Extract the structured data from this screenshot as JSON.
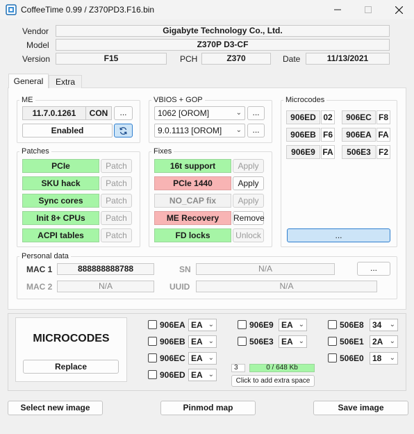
{
  "window": {
    "title": "CoffeeTime 0.99  /  Z370PD3.F16.bin"
  },
  "info": {
    "vendor_label": "Vendor",
    "vendor": "Gigabyte Technology Co., Ltd.",
    "model_label": "Model",
    "model": "Z370P D3-CF",
    "version_label": "Version",
    "version": "F15",
    "pch_label": "PCH",
    "pch": "Z370",
    "date_label": "Date",
    "date": "11/13/2021"
  },
  "tabs": [
    "General",
    "Extra"
  ],
  "me": {
    "title": "ME",
    "version": "11.7.0.1261",
    "con": "CON",
    "more": "...",
    "status": "Enabled"
  },
  "vbios": {
    "title": "VBIOS + GOP",
    "vbios_value": "1062 [OROM]",
    "gop_value": "9.0.1113 [OROM]",
    "more": "..."
  },
  "microcodes_group": {
    "title": "Microcodes",
    "items": [
      {
        "cpuid": "906ED",
        "rev": "02"
      },
      {
        "cpuid": "906EC",
        "rev": "F8"
      },
      {
        "cpuid": "906EB",
        "rev": "F6"
      },
      {
        "cpuid": "906EA",
        "rev": "FA"
      },
      {
        "cpuid": "906E9",
        "rev": "FA"
      },
      {
        "cpuid": "506E3",
        "rev": "F2"
      }
    ],
    "more": "..."
  },
  "patches": {
    "title": "Patches",
    "items": [
      {
        "label": "PCIe",
        "action": "Patch"
      },
      {
        "label": "SKU hack",
        "action": "Patch"
      },
      {
        "label": "Sync cores",
        "action": "Patch"
      },
      {
        "label": "Init 8+ CPUs",
        "action": "Patch"
      },
      {
        "label": "ACPI tables",
        "action": "Patch"
      }
    ]
  },
  "fixes": {
    "title": "Fixes",
    "items": [
      {
        "label": "16t support",
        "action": "Apply",
        "state": "green",
        "action_enabled": false
      },
      {
        "label": "PCIe 1440",
        "action": "Apply",
        "state": "pink",
        "action_enabled": true
      },
      {
        "label": "NO_CAP fix",
        "action": "Apply",
        "state": "grey",
        "action_enabled": false
      },
      {
        "label": "ME Recovery",
        "action": "Remove",
        "state": "pink",
        "action_enabled": true
      },
      {
        "label": "FD locks",
        "action": "Unlock",
        "state": "green",
        "action_enabled": false
      }
    ]
  },
  "personal": {
    "title": "Personal data",
    "mac1_label": "MAC 1",
    "mac1": "888888888788",
    "sn_label": "SN",
    "sn": "N/A",
    "mac2_label": "MAC 2",
    "mac2": "N/A",
    "uuid_label": "UUID",
    "uuid": "N/A",
    "more": "..."
  },
  "bottom": {
    "heading": "MICROCODES",
    "replace": "Replace",
    "checks": [
      {
        "label": "906EA",
        "value": "EA"
      },
      {
        "label": "906EB",
        "value": "EA"
      },
      {
        "label": "906EC",
        "value": "EA"
      },
      {
        "label": "906ED",
        "value": "EA"
      },
      {
        "label": "906E9",
        "value": "EA"
      },
      {
        "label": "506E3",
        "value": "EA"
      },
      {
        "label": "506E8",
        "value": "34"
      },
      {
        "label": "506E1",
        "value": "2A"
      },
      {
        "label": "506E0",
        "value": "18"
      }
    ],
    "count": "3",
    "space": "0 / 648 Kb",
    "space_fraction": 0.0,
    "add_space": "Click to add extra space"
  },
  "actions": {
    "select": "Select new image",
    "pinmod": "Pinmod map",
    "save": "Save image"
  },
  "colors": {
    "patch_on": "#a6f5a6",
    "fix_warn": "#f8b4b4",
    "accent": "#2f7fcf"
  }
}
